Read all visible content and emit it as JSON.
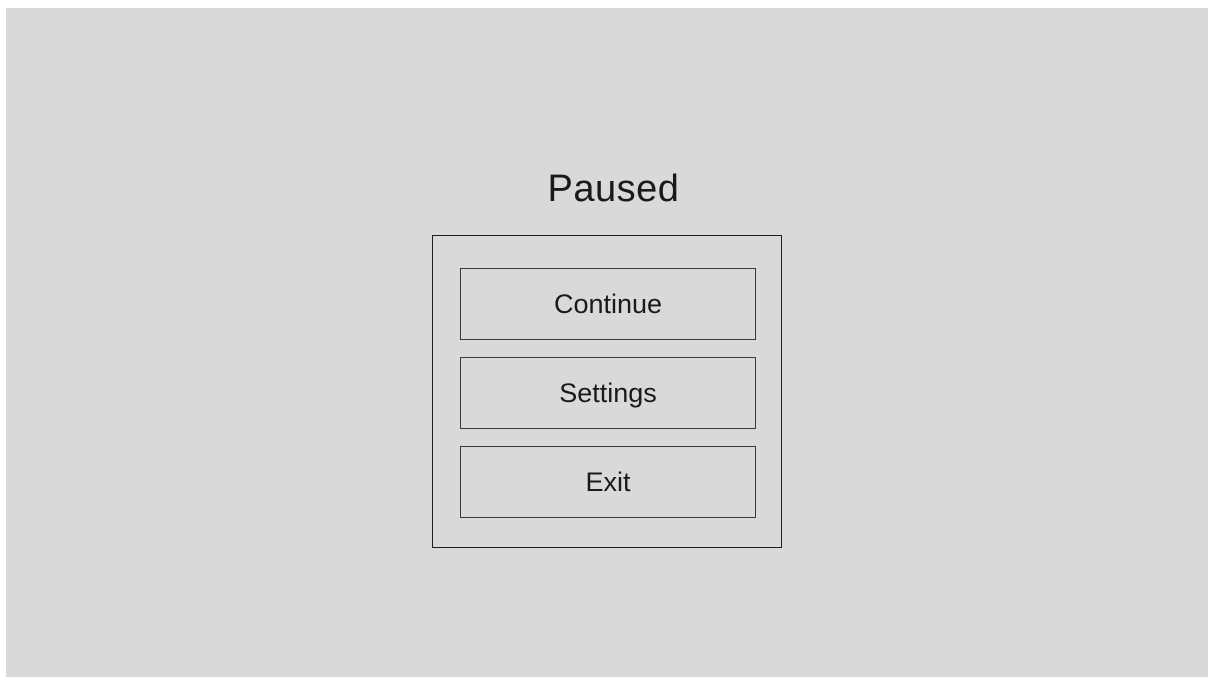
{
  "menu": {
    "title": "Paused",
    "buttons": {
      "continue_label": "Continue",
      "settings_label": "Settings",
      "exit_label": "Exit"
    }
  },
  "colors": {
    "background": "#d9d9d9",
    "border": "#1f1f1f",
    "text": "#1a1a1a"
  }
}
